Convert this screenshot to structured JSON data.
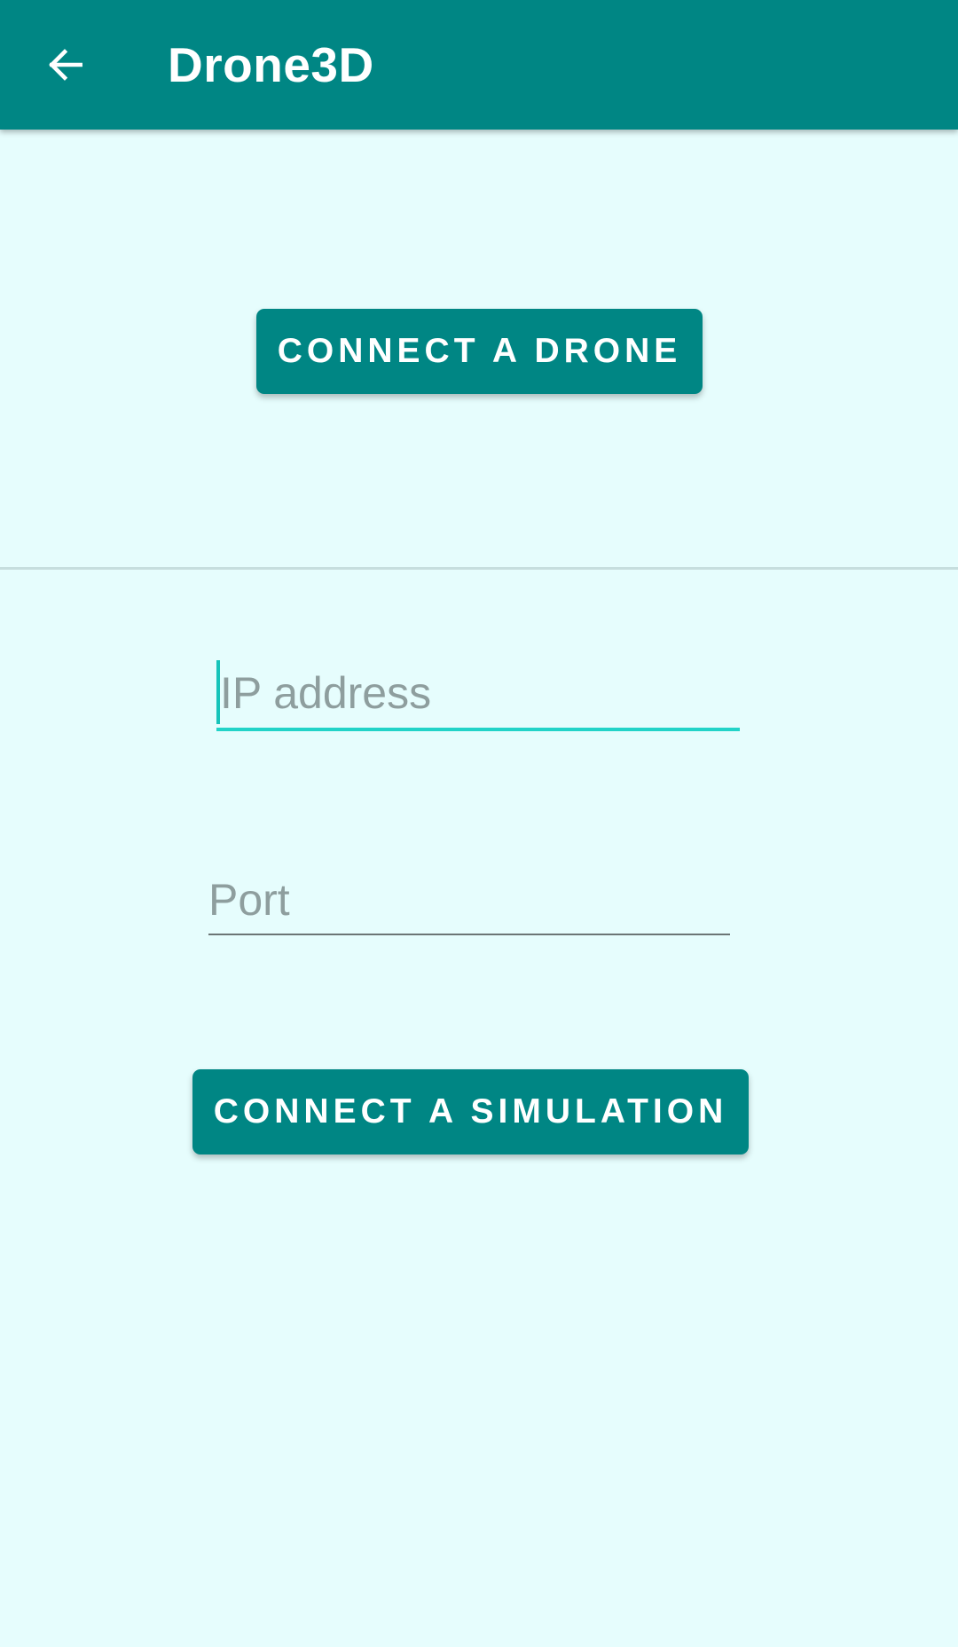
{
  "appbar": {
    "title": "Drone3D",
    "back_icon": "arrow-left-icon"
  },
  "drone_section": {
    "connect_label": "CONNECT A DRONE"
  },
  "simulation_section": {
    "ip_placeholder": "IP address",
    "ip_value": "",
    "port_placeholder": "Port",
    "port_value": "",
    "connect_label": "CONNECT A SIMULATION"
  },
  "colors": {
    "primary": "#008684",
    "background": "#e6fdfd",
    "accent": "#22d3c8"
  }
}
